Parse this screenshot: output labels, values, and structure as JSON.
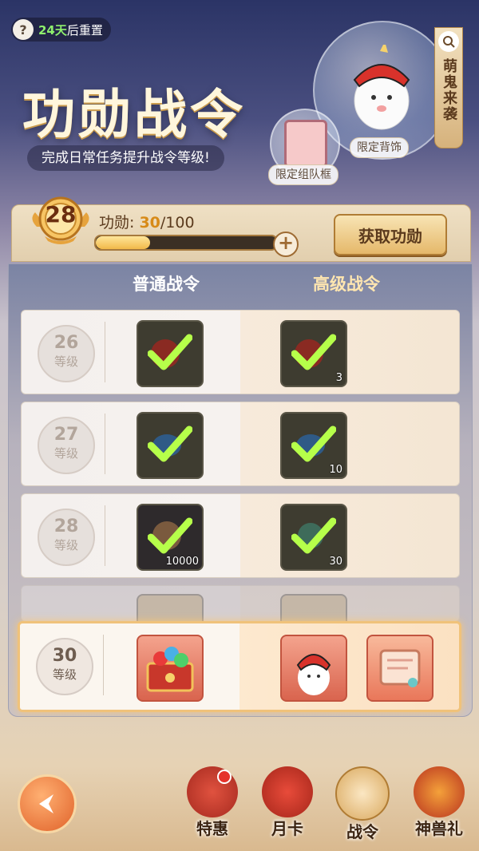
{
  "header": {
    "help_icon": "?",
    "reset_days": "24天",
    "reset_suffix": "后重置",
    "title": "功勋战令",
    "subtitle": "完成日常任务提升战令等级!"
  },
  "promo": {
    "side_banner": "萌鬼来袭",
    "limited_ornament": "限定背饰",
    "limited_frame": "限定组队框"
  },
  "progress": {
    "level": "28",
    "label": "功勋:",
    "current": "30",
    "max": "/100",
    "fill_fraction": 0.3,
    "plus": "+",
    "get_button": "获取功勋"
  },
  "columns": {
    "normal": "普通战令",
    "advanced": "高级战令"
  },
  "rows": [
    {
      "level": "26",
      "unit": "等级",
      "normal_qty": "",
      "advanced_qty": "3"
    },
    {
      "level": "27",
      "unit": "等级",
      "normal_qty": "",
      "advanced_qty": "10"
    },
    {
      "level": "28",
      "unit": "等级",
      "normal_qty": "10000",
      "advanced_qty": "30"
    },
    {
      "level": "30",
      "unit": "等级"
    }
  ],
  "nav": {
    "back": "←",
    "items": [
      "特惠",
      "月卡",
      "战令",
      "神兽礼"
    ]
  }
}
